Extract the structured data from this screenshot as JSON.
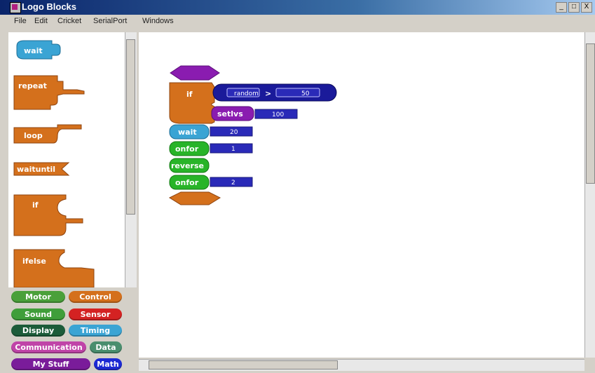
{
  "window": {
    "title": "Logo Blocks",
    "buttons": {
      "minimize": "_",
      "maximize": "□",
      "close": "X"
    }
  },
  "menu": [
    "File",
    "Edit",
    "Cricket",
    "SerialPort",
    "Windows"
  ],
  "palette_blocks": [
    "wait",
    "repeat",
    "loop",
    "waituntil",
    "if",
    "ifelse"
  ],
  "categories": [
    {
      "label": "Motor",
      "color": "#4aa03a"
    },
    {
      "label": "Control",
      "color": "#d4701c"
    },
    {
      "label": "Sound",
      "color": "#3f9e3a"
    },
    {
      "label": "Sensor",
      "color": "#d42222"
    },
    {
      "label": "Display",
      "color": "#1c5c3a"
    },
    {
      "label": "Timing",
      "color": "#3aa4d4"
    },
    {
      "label": "Communication",
      "color": "#c044a8"
    },
    {
      "label": "Data",
      "color": "#4a8e6e"
    },
    {
      "label": "My Stuff",
      "color": "#7a1c9a"
    },
    {
      "label": "Math",
      "color": "#1c2ad4"
    }
  ],
  "program": {
    "if_label": "if",
    "condition": {
      "left": "random",
      "op": ">",
      "right": "50"
    },
    "setlvs": {
      "label": "setlvs",
      "value": "100"
    },
    "steps": [
      {
        "label": "wait",
        "value": "20"
      },
      {
        "label": "onfor",
        "value": "1"
      },
      {
        "label": "reverse",
        "value": ""
      },
      {
        "label": "onfor",
        "value": "2"
      }
    ]
  },
  "colors": {
    "control": "#d4701c",
    "timing": "#3aa4d4",
    "motor": "#28b428",
    "number": "#2a2ab8",
    "condition": "#1a1a9a",
    "mystuff": "#8a1cb0",
    "start": "#8a1cb0"
  }
}
